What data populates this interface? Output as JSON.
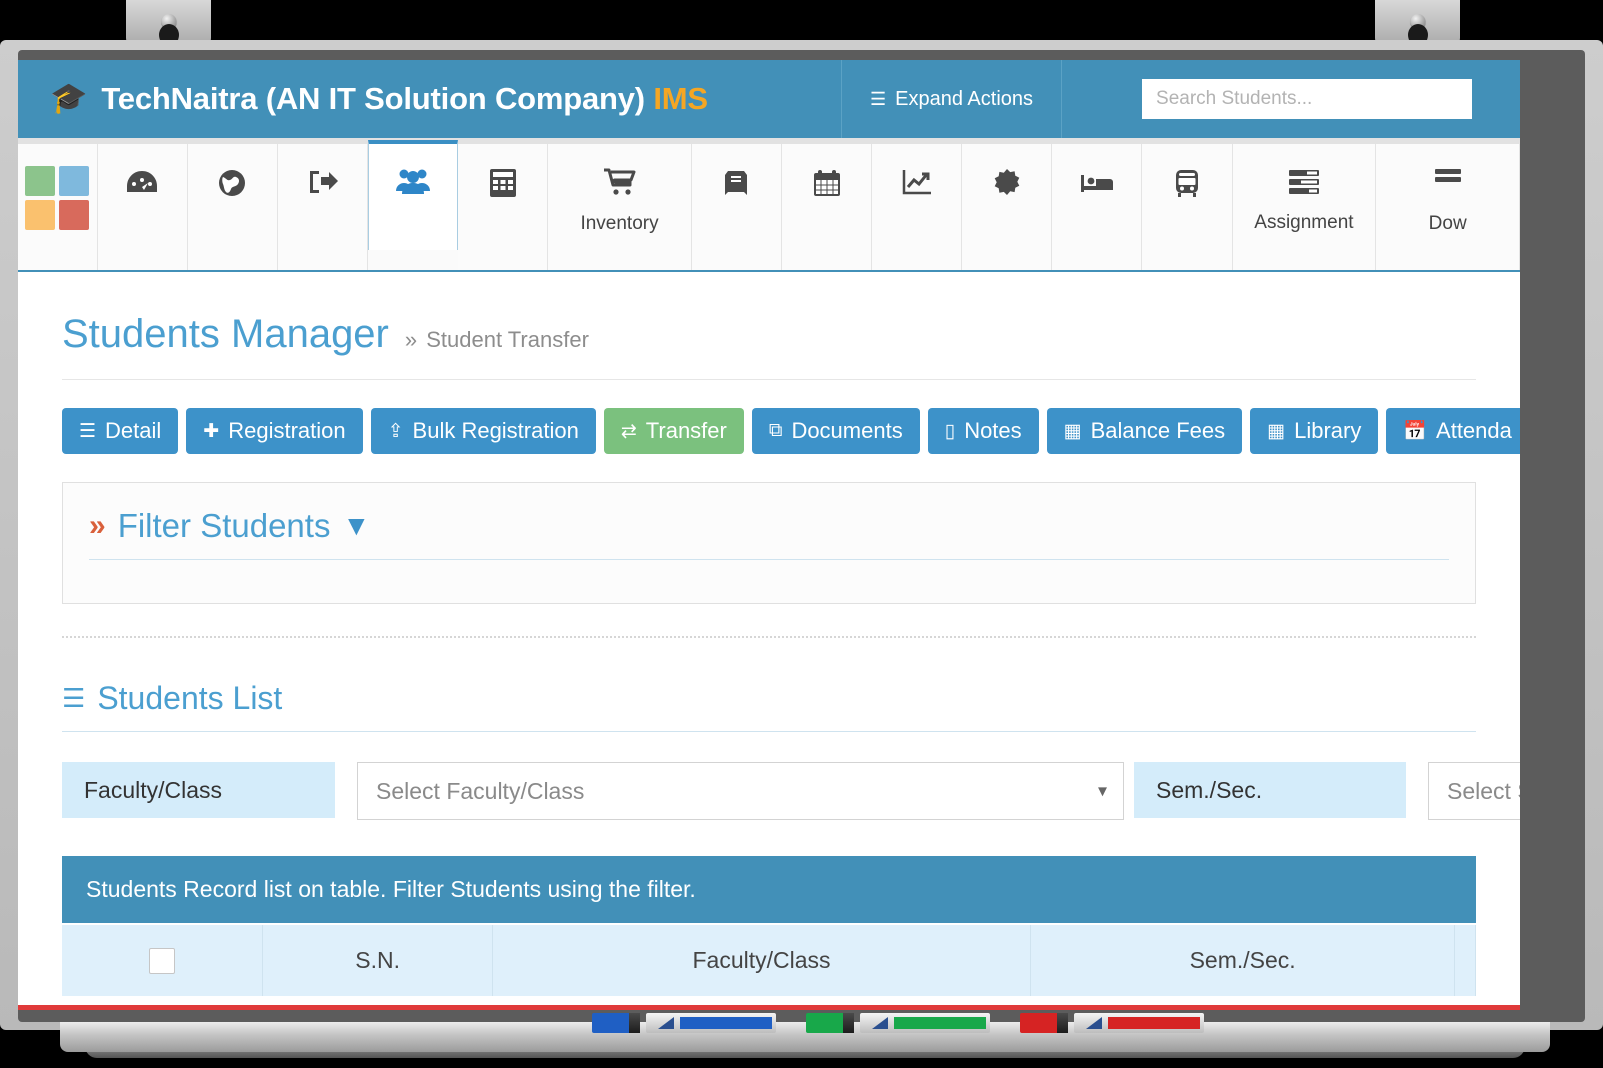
{
  "header": {
    "brand_icon": "graduation-cap-icon",
    "brand_name": "TechNaitra (AN IT Solution Company)",
    "brand_suffix": "IMS",
    "expand_actions_icon": "list-icon",
    "expand_actions_label": "Expand Actions",
    "search_placeholder": "Search Students...",
    "search_value": "",
    "bar_color": "#4290b8",
    "accent_color": "#f5a623"
  },
  "nav": {
    "logo_colors": [
      "#8cc48c",
      "#7fb9dd",
      "#fac16e",
      "#d86a5c"
    ],
    "items": [
      {
        "icon": "app-grid-logo",
        "label": "",
        "active": false
      },
      {
        "icon": "dashboard-icon",
        "label": "",
        "active": false
      },
      {
        "icon": "globe-icon",
        "label": "",
        "active": false
      },
      {
        "icon": "logout-icon",
        "label": "",
        "active": false
      },
      {
        "icon": "users-icon",
        "label": "",
        "active": true
      },
      {
        "icon": "calculator-icon",
        "label": "",
        "active": false
      },
      {
        "icon": "shopping-cart-icon",
        "label": "Inventory",
        "active": false
      },
      {
        "icon": "book-icon",
        "label": "",
        "active": false
      },
      {
        "icon": "calendar-icon",
        "label": "",
        "active": false
      },
      {
        "icon": "chart-line-icon",
        "label": "",
        "active": false
      },
      {
        "icon": "certificate-icon",
        "label": "",
        "active": false
      },
      {
        "icon": "bed-icon",
        "label": "",
        "active": false
      },
      {
        "icon": "bus-icon",
        "label": "",
        "active": false
      },
      {
        "icon": "tasks-icon",
        "label": "Assignment",
        "active": false
      },
      {
        "icon": "download-icon",
        "label": "Dow",
        "active": false
      }
    ]
  },
  "page": {
    "title": "Students Manager",
    "breadcrumb_chevron": "»",
    "breadcrumb": "Student Transfer"
  },
  "toolbar": {
    "buttons": [
      {
        "label": "Detail",
        "icon": "list-icon",
        "style": "blue"
      },
      {
        "label": "Registration",
        "icon": "plus-icon",
        "style": "blue"
      },
      {
        "label": "Bulk Registration",
        "icon": "upload-icon",
        "style": "blue"
      },
      {
        "label": "Transfer",
        "icon": "exchange-icon",
        "style": "green"
      },
      {
        "label": "Documents",
        "icon": "copy-icon",
        "style": "blue"
      },
      {
        "label": "Notes",
        "icon": "note-icon",
        "style": "blue"
      },
      {
        "label": "Balance Fees",
        "icon": "calculator-icon",
        "style": "blue"
      },
      {
        "label": "Library",
        "icon": "calculator-icon",
        "style": "blue"
      },
      {
        "label": "Attenda",
        "icon": "calendar-icon",
        "style": "blue"
      }
    ]
  },
  "filter_panel": {
    "chevron": "»",
    "title": "Filter Students",
    "funnel_icon": "filter-funnel-icon"
  },
  "students_list": {
    "icon": "list-icon",
    "title": "Students List",
    "filters": [
      {
        "label": "Faculty/Class",
        "placeholder": "Select Faculty/Class",
        "value": ""
      },
      {
        "label": "Sem./Sec.",
        "placeholder": "Select S",
        "value": ""
      }
    ],
    "table": {
      "banner": "Students Record list on table. Filter Students using the filter.",
      "columns": [
        "",
        "S.N.",
        "Faculty/Class",
        "Sem./Sec.",
        ""
      ],
      "rows": []
    }
  },
  "device": {
    "markers": [
      {
        "color_name": "blue",
        "hex": "#1f5fc4"
      },
      {
        "color_name": "green",
        "hex": "#18a84a"
      },
      {
        "color_name": "red",
        "hex": "#d62323"
      }
    ]
  }
}
